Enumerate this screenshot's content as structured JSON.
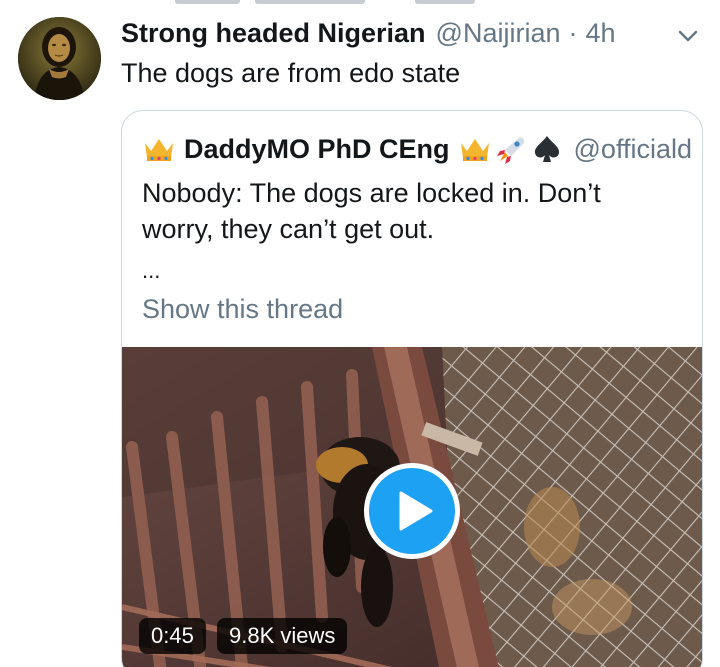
{
  "tweet": {
    "author_name": "Strong headed Nigerian",
    "author_handle": "@Naijirian",
    "separator": "·",
    "time": "4h",
    "text": "The dogs are from edo state",
    "avatar_icon": "mona-lisa-avatar",
    "menu_icon": "chevron-down-icon"
  },
  "quote": {
    "author_name": "DaddyMO PhD CEng",
    "author_handle": "@officiald",
    "emojis": [
      "crown-icon",
      "crown-icon",
      "rocket-icon",
      "spade-icon"
    ],
    "text_lines": [
      "Nobody: The dogs are locked in. Don’t",
      "worry, they can’t get out."
    ],
    "ellipsis": "...",
    "show_thread": "Show this thread"
  },
  "media": {
    "type": "video",
    "duration": "0:45",
    "views": "9.8K views",
    "play_icon": "play-icon"
  },
  "colors": {
    "accent": "#1da1f2",
    "secondary_text": "#657786",
    "border": "#ccd6dd"
  }
}
